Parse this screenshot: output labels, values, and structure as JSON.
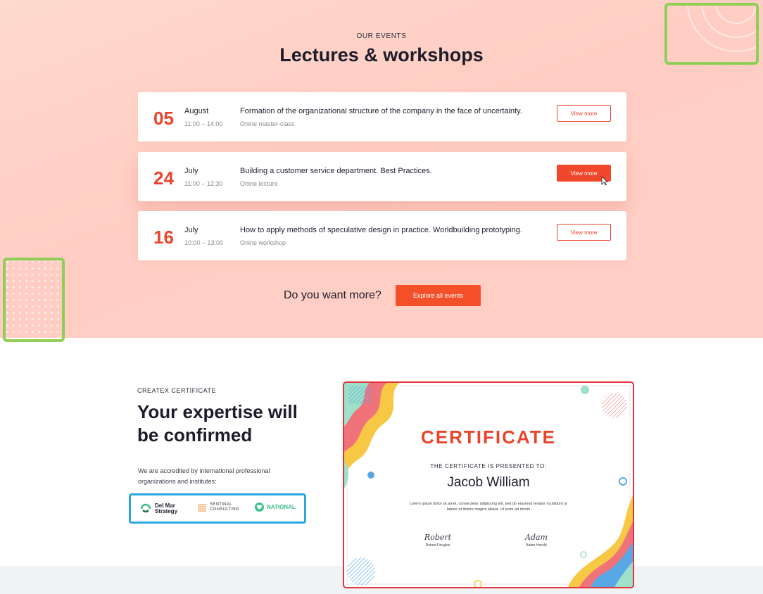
{
  "events_section": {
    "eyebrow": "OUR EVENTS",
    "title": "Lectures & workshops",
    "events": [
      {
        "day": "05",
        "month": "August",
        "time": "11:00 – 14:00",
        "title": "Formation of the organizational structure of the company in the face of uncertainty.",
        "type": "Onine master-class",
        "button": "View more"
      },
      {
        "day": "24",
        "month": "July",
        "time": "11:00 – 12:30",
        "title": "Building a customer service department. Best Practices.",
        "type": "Onine lecture",
        "button": "View more"
      },
      {
        "day": "16",
        "month": "July",
        "time": "10:00 – 13:00",
        "title": "How to apply methods of speculative design in practice. Worldbuilding prototyping.",
        "type": "Onine workshop",
        "button": "View more"
      }
    ],
    "more_prompt": "Do you want more?",
    "explore_button": "Explore all events"
  },
  "certificate_section": {
    "eyebrow": "CREATEX CERTIFICATE",
    "heading": "Your expertise will be confirmed",
    "description": "We are accredited by international professional organizations and institutes:",
    "partners": [
      {
        "name_line1": "Del Mar",
        "name_line2": "Strategy",
        "icon": "del-mar-logo-icon"
      },
      {
        "name_line1": "SENTINAL",
        "name_line2": "CONSULTING",
        "icon": "sentinal-logo-icon"
      },
      {
        "name_line1": "NATIONAL",
        "icon": "national-heart-logo-icon"
      }
    ],
    "certificate": {
      "word": "CERTIFICATE",
      "presented_to": "THE CERTIFICATE IS PRESENTED TO:",
      "name": "Jacob William",
      "body": "Lorem ipsum dolor sit amet, consectetur adipiscing elit, sed do eiusmod tempor incididunt ut labore et dolore magna aliqua. Ut enim ad minim",
      "signatures": [
        {
          "script": "Robert",
          "name": "Robert Douglas"
        },
        {
          "script": "Adam",
          "name": "Adam Harold"
        }
      ]
    }
  },
  "colors": {
    "accent": "#f0482a",
    "date": "#e8452c",
    "highlight_green": "#8fcf56",
    "highlight_blue": "#2aa7e0",
    "highlight_red": "#e0353f"
  }
}
